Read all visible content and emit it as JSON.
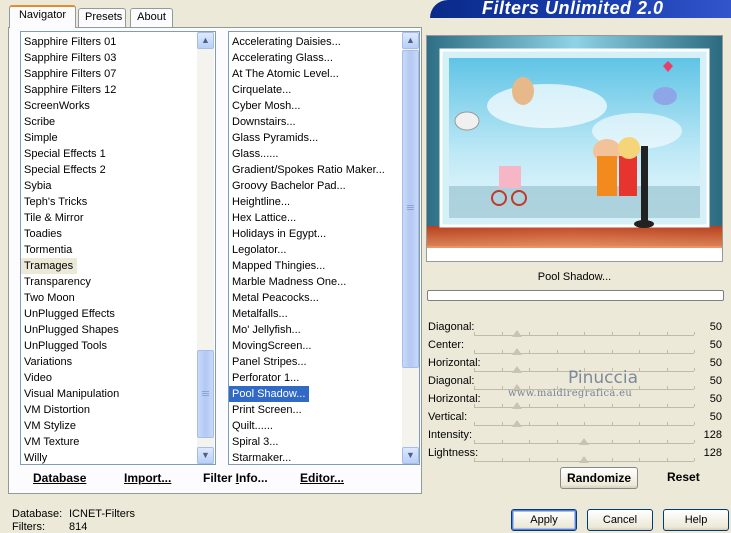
{
  "window": {
    "title": "Filters Unlimited 2.0"
  },
  "tabs": [
    {
      "label": "Navigator"
    },
    {
      "label": "Presets"
    },
    {
      "label": "About"
    }
  ],
  "categories": {
    "selected": "Tramages",
    "items": [
      "Sapphire Filters 01",
      "Sapphire Filters 03",
      "Sapphire Filters 07",
      "Sapphire Filters 12",
      "ScreenWorks",
      "Scribe",
      "Simple",
      "Special Effects 1",
      "Special Effects 2",
      "Sybia",
      "Teph's Tricks",
      "Tile & Mirror",
      "Toadies",
      "Tormentia",
      "Tramages",
      "Transparency",
      "Two Moon",
      "UnPlugged Effects",
      "UnPlugged Shapes",
      "UnPlugged Tools",
      "Variations",
      "Video",
      "Visual Manipulation",
      "VM Distortion",
      "VM Stylize",
      "VM Texture",
      "Willy"
    ]
  },
  "filters": {
    "selected": "Pool Shadow...",
    "items": [
      "Accelerating Daisies...",
      "Accelerating Glass...",
      "At The Atomic Level...",
      "Cirquelate...",
      "Cyber Mosh...",
      "Downstairs...",
      "Glass Pyramids...",
      "Glass......",
      "Gradient/Spokes Ratio Maker...",
      "Groovy Bachelor Pad...",
      "Heightline...",
      "Hex Lattice...",
      "Holidays in Egypt...",
      "Legolator...",
      "Mapped Thingies...",
      "Marble Madness One...",
      "Metal Peacocks...",
      "Metalfalls...",
      "Mo' Jellyfish...",
      "MovingScreen...",
      "Panel Stripes...",
      "Perforator 1...",
      "Pool Shadow...",
      "Print Screen...",
      "Quilt......",
      "Spiral 3...",
      "Starmaker..."
    ]
  },
  "bottom_buttons": {
    "database": {
      "u": "D",
      "rest": "atabase"
    },
    "import": {
      "u": "I",
      "rest": "mport..."
    },
    "filter_info": {
      "pre": "Filter ",
      "u": "I",
      "rest": "nfo..."
    },
    "editor": {
      "u": "E",
      "rest": "ditor..."
    }
  },
  "preview": {
    "filter_name": "Pool Shadow...",
    "progress": 0
  },
  "parameters": [
    {
      "label": "Diagonal:",
      "value": 50
    },
    {
      "label": "Center:",
      "value": 50
    },
    {
      "label": "Horizontal:",
      "value": 50
    },
    {
      "label": "Diagonal:",
      "value": 50
    },
    {
      "label": "Horizontal:",
      "value": 50
    },
    {
      "label": "Vertical:",
      "value": 50
    },
    {
      "label": "Intensity:",
      "value": 128
    },
    {
      "label": "Lightness:",
      "value": 128
    }
  ],
  "param_range_max": 255,
  "watermark": {
    "name": "Pinuccia",
    "url": "www.maidiregrafica.eu"
  },
  "actions": {
    "randomize": "Randomize",
    "reset": "Reset",
    "apply": "Apply",
    "cancel": "Cancel",
    "help": "Help"
  },
  "status": {
    "database_label": "Database:",
    "database_value": "ICNET-Filters",
    "filters_label": "Filters:",
    "filters_value": "814"
  },
  "colors": {
    "selection": "#316ac5",
    "dialog_bg": "#ece9d8",
    "banner": "#1a3fb0"
  }
}
